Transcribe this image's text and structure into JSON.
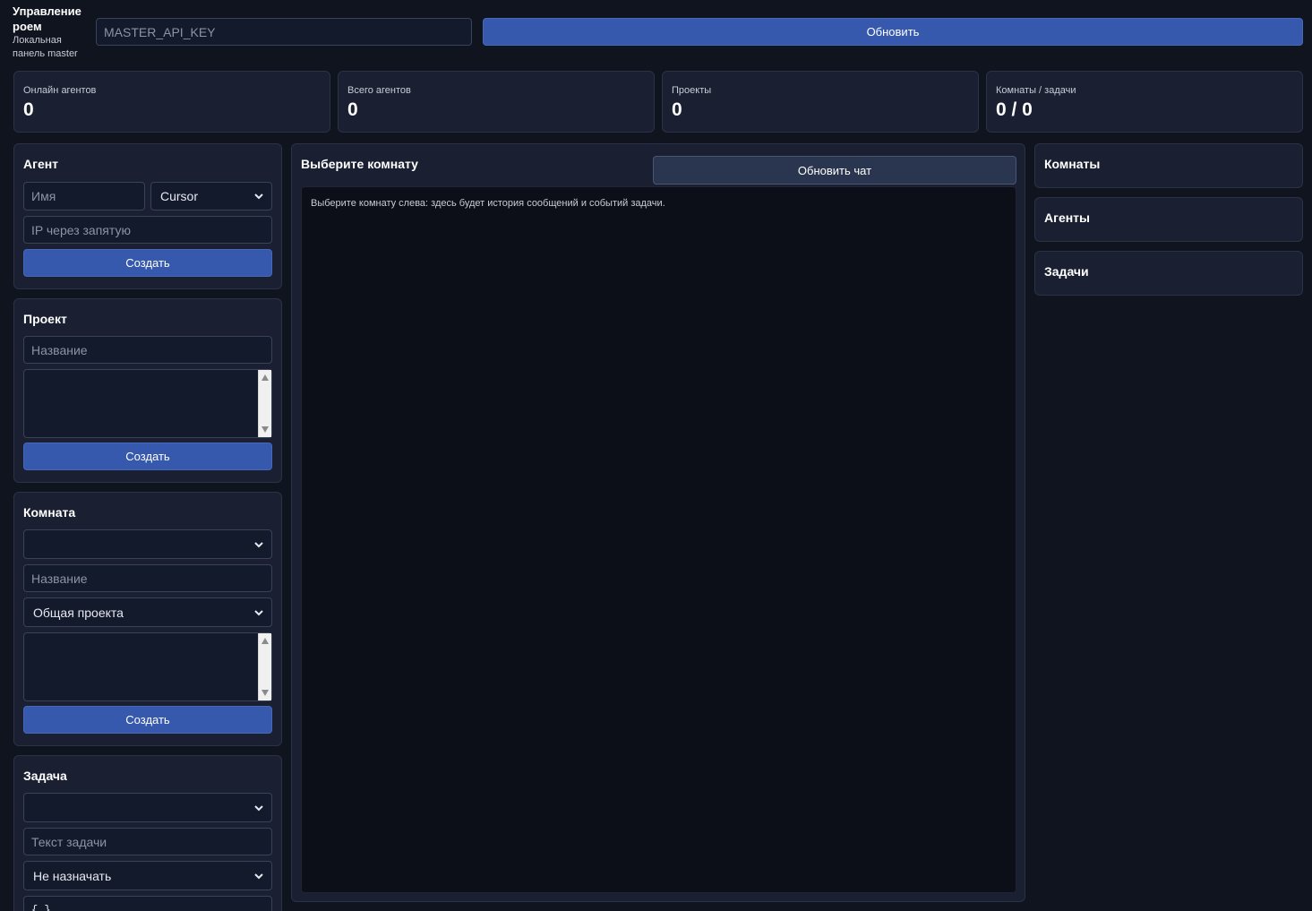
{
  "header": {
    "brand_title": "Управление роем",
    "brand_subtitle": "Локальная панель master",
    "api_key_placeholder": "MASTER_API_KEY",
    "refresh_label": "Обновить"
  },
  "stats": [
    {
      "label": "Онлайн агентов",
      "value": "0"
    },
    {
      "label": "Всего агентов",
      "value": "0"
    },
    {
      "label": "Проекты",
      "value": "0"
    },
    {
      "label": "Комнаты / задачи",
      "value": "0 / 0"
    }
  ],
  "agent_form": {
    "title": "Агент",
    "name_placeholder": "Имя",
    "type_selected": "Cursor",
    "ip_placeholder": "IP через запятую",
    "create_label": "Создать"
  },
  "project_form": {
    "title": "Проект",
    "name_placeholder": "Название",
    "create_label": "Создать"
  },
  "room_form": {
    "title": "Комната",
    "project_selected": "",
    "name_placeholder": "Название",
    "type_selected": "Общая проекта",
    "create_label": "Создать"
  },
  "task_form": {
    "title": "Задача",
    "room_selected": "",
    "text_placeholder": "Текст задачи",
    "assign_selected": "Не назначать",
    "json_value": "{ }"
  },
  "chat": {
    "title": "Выберите комнату",
    "refresh_label": "Обновить чат",
    "empty_text": "Выберите комнату слева: здесь будет история сообщений и событий задачи."
  },
  "right_panels": {
    "rooms_title": "Комнаты",
    "agents_title": "Агенты",
    "tasks_title": "Задачи"
  },
  "colors": {
    "background": "#10141e",
    "panel": "#1a2031",
    "primary": "#3658ad",
    "chat_bg": "#0c0f18"
  }
}
